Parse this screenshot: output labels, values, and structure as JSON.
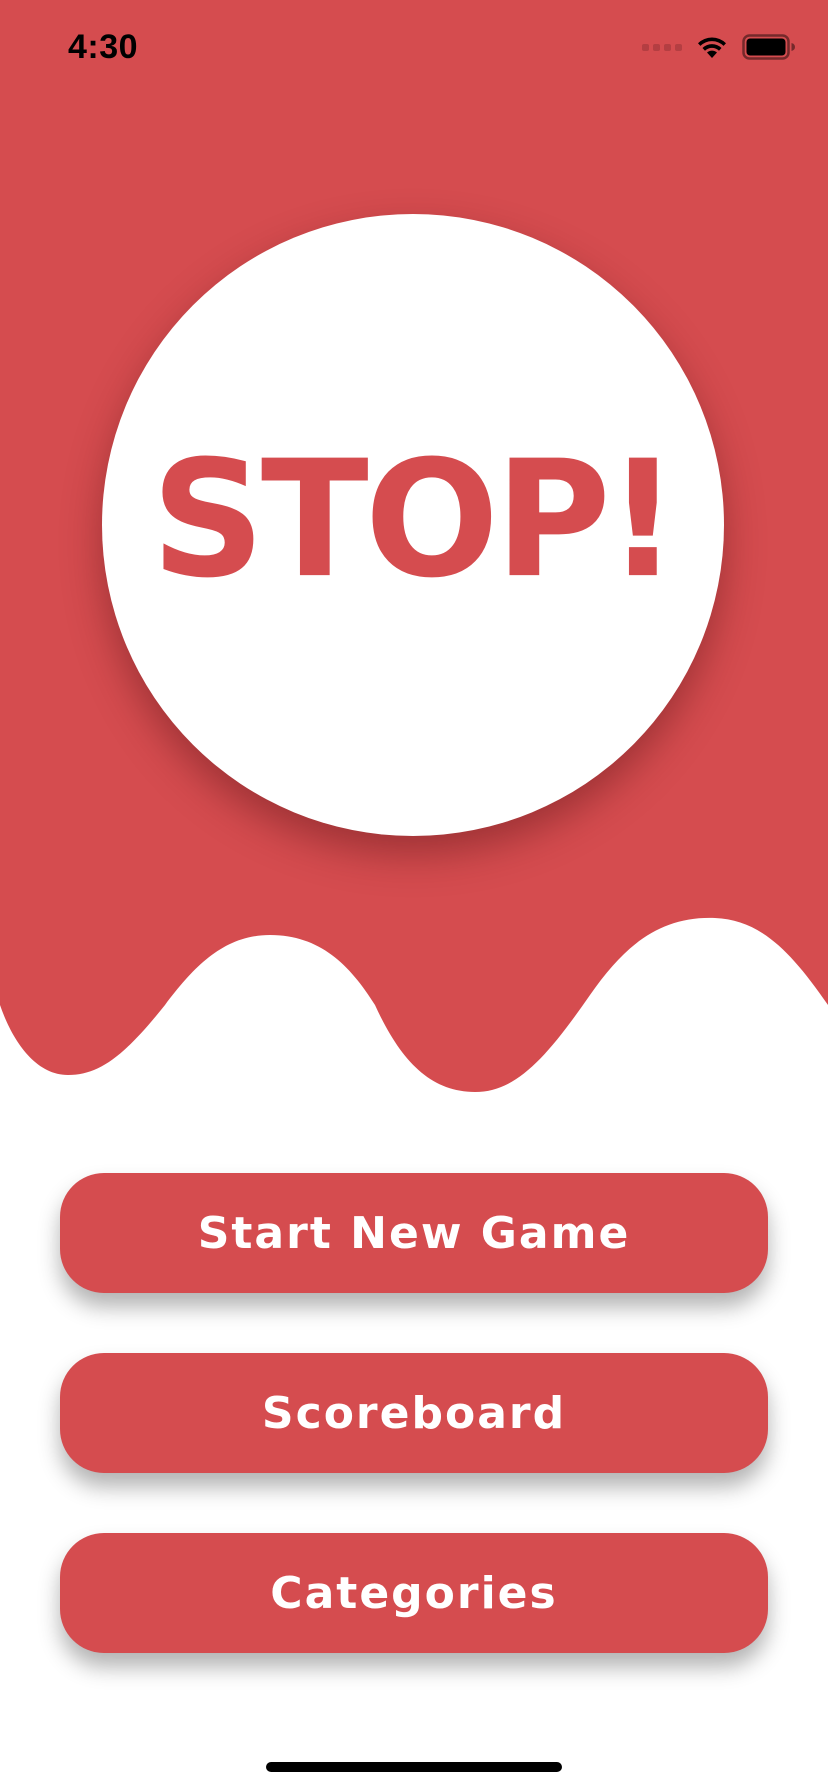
{
  "status_bar": {
    "time": "4:30",
    "icons": [
      "cellular-signal-icon",
      "wifi-icon",
      "battery-icon"
    ]
  },
  "logo": {
    "text": "STOP!"
  },
  "menu": {
    "start_label": "Start New Game",
    "scoreboard_label": "Scoreboard",
    "categories_label": "Categories"
  },
  "colors": {
    "brand_red": "#d54c4f",
    "background": "#ffffff",
    "text_on_brand": "#ffffff"
  }
}
